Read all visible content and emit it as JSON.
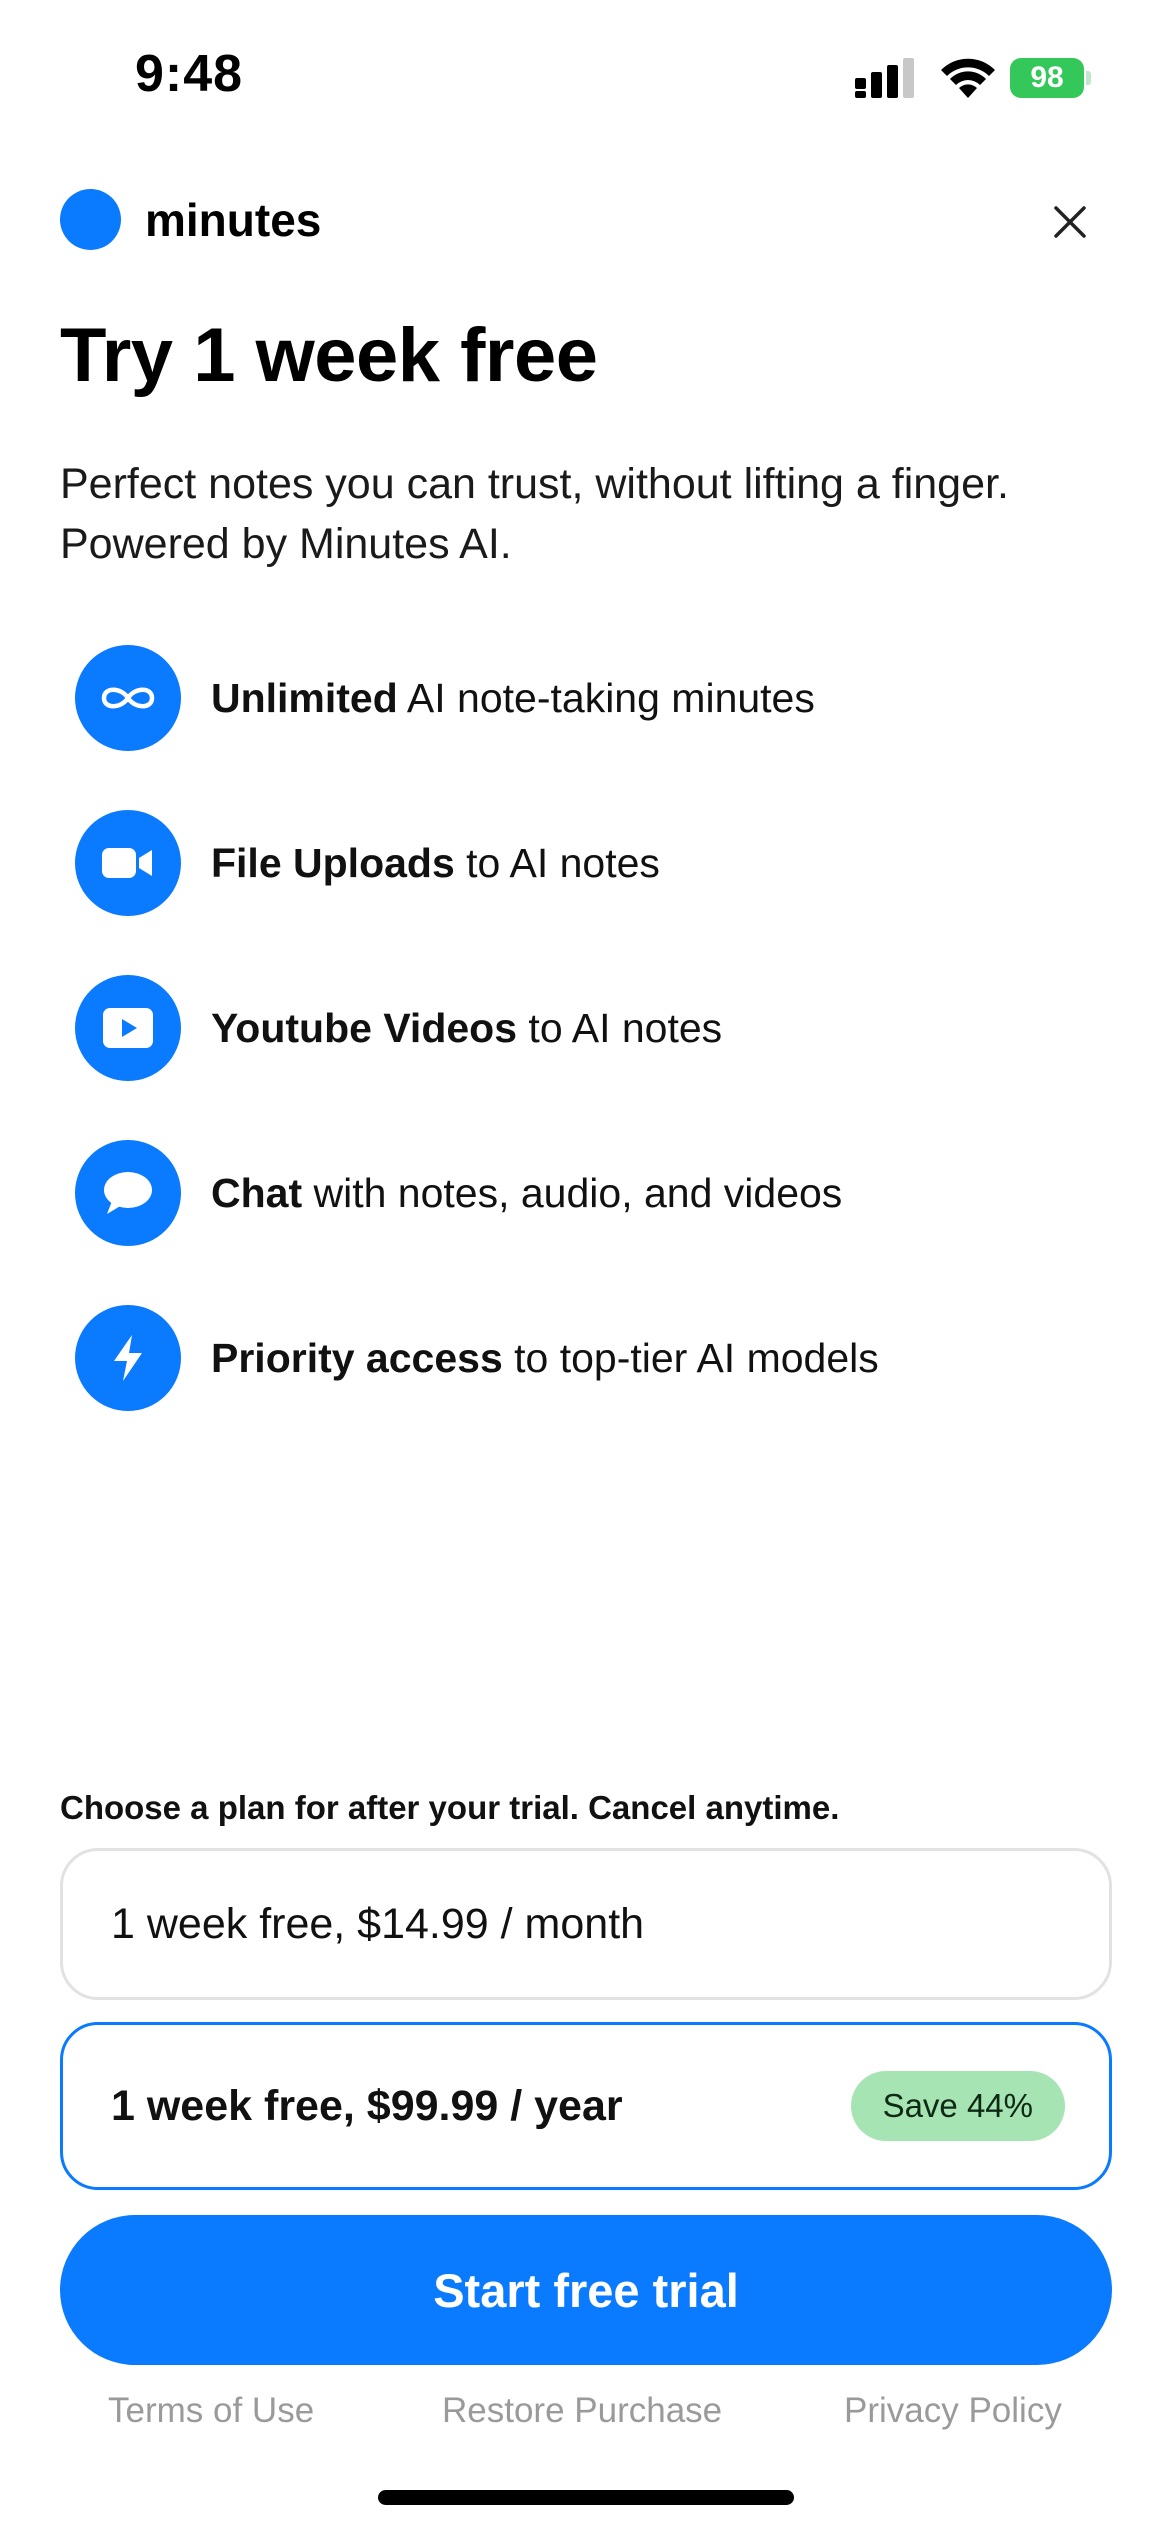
{
  "status_bar": {
    "time": "9:48",
    "battery": "98",
    "icons": [
      "cellular-signal-icon",
      "wifi-icon",
      "battery-charging-icon"
    ]
  },
  "header": {
    "brand_name": "minutes",
    "close_icon": "close-icon"
  },
  "title": "Try 1 week free",
  "subtitle": "Perfect notes you can trust, without lifting a finger. Powered by Minutes AI.",
  "features": [
    {
      "icon": "infinity-icon",
      "bold": "Unlimited",
      "text": " AI note-taking minutes"
    },
    {
      "icon": "video-camera-icon",
      "bold": "File Uploads",
      "text": " to AI notes"
    },
    {
      "icon": "play-icon",
      "bold": "Youtube Videos",
      "text": " to AI notes"
    },
    {
      "icon": "chat-bubble-icon",
      "bold": "Chat",
      "text": " with notes, audio, and videos"
    },
    {
      "icon": "lightning-bolt-icon",
      "bold": "Priority access",
      "text": " to top-tier AI models"
    }
  ],
  "plans": {
    "caption": "Choose a plan for after your trial. Cancel anytime.",
    "monthly": {
      "label": "1 week free, $14.99 / month"
    },
    "yearly": {
      "label": "1 week free, $99.99 / year",
      "badge": "Save 44%",
      "selected": true
    }
  },
  "cta": {
    "label": "Start free trial"
  },
  "footer": {
    "terms": "Terms of Use",
    "restore": "Restore Purchase",
    "privacy": "Privacy Policy"
  },
  "colors": {
    "accent": "#0a7aff",
    "badge_bg": "#a6e4b3",
    "battery": "#34c759",
    "footer_text": "#9a9a9a"
  }
}
